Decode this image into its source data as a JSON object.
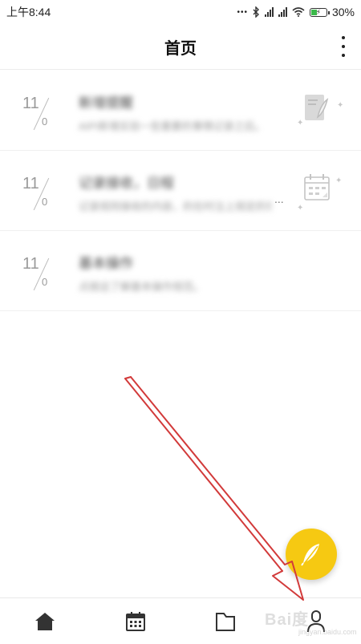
{
  "status_bar": {
    "time": "上午8:44",
    "battery": "30%"
  },
  "header": {
    "title": "首页"
  },
  "list": [
    {
      "month": "11",
      "day": "0",
      "title": "新增提醒",
      "desc": "AIPI新增实验一些重要的事情记录之后。",
      "thumb_icon": "note-pen-icon"
    },
    {
      "month": "11",
      "day": "0",
      "title": "记录接收，日程",
      "desc": "记录规则接收的内容，的在时注上规定的事情",
      "thumb_icon": "calendar-note-icon"
    },
    {
      "month": "11",
      "day": "0",
      "title": "基本操作",
      "desc": "点按这了解基本操作规范。",
      "thumb_icon": ""
    }
  ],
  "list_item_ellipsis": "...",
  "fab_icon": "feather-pen-icon",
  "bottom_nav": [
    {
      "icon": "home-icon"
    },
    {
      "icon": "calendar-icon"
    },
    {
      "icon": "folder-icon"
    },
    {
      "icon": "profile-icon"
    }
  ],
  "watermark": {
    "main": "Bai度",
    "sub": "jingyan.baidu.com"
  },
  "colors": {
    "fab": "#f6c912",
    "annotation_arrow": "#d23a3a",
    "date_text": "#9a9a9a"
  }
}
